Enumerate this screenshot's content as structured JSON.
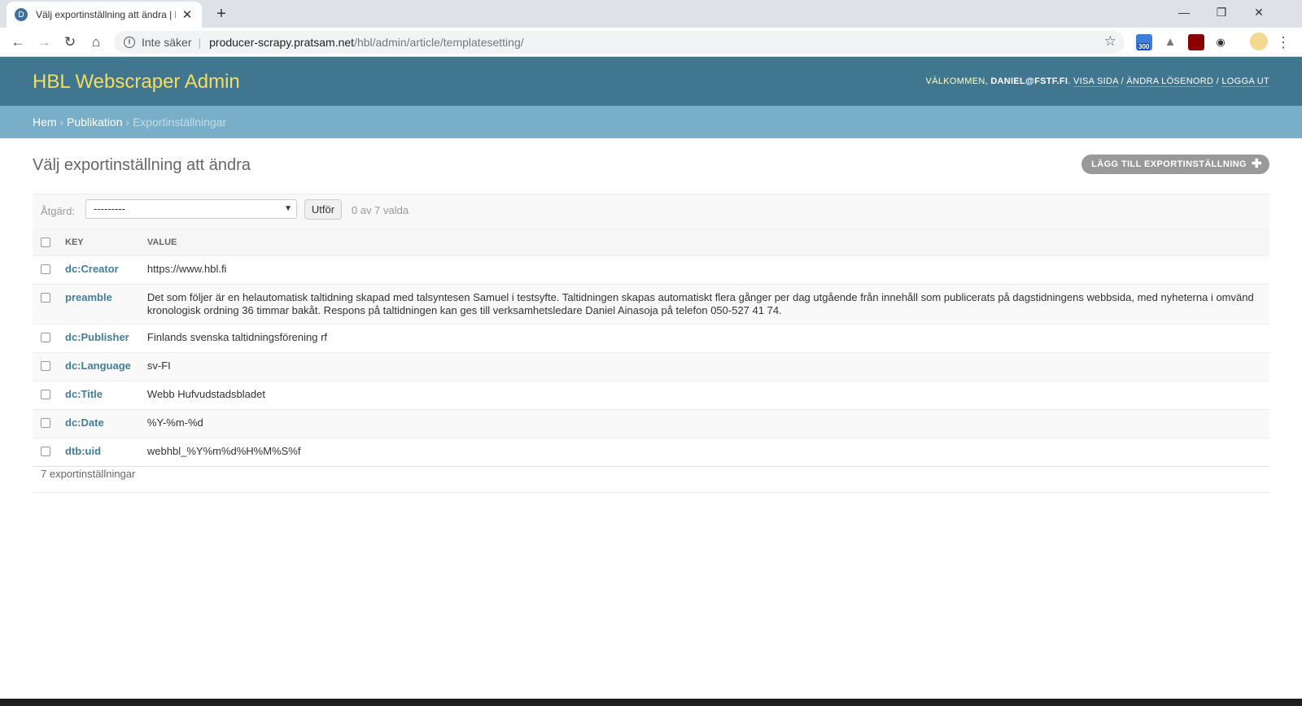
{
  "browser": {
    "tab_title": "Välj exportinställning att ändra | HBL Webscraper Admin",
    "tab_favicon_letter": "D",
    "security_label": "Inte säker",
    "url_host": "producer-scrapy.pratsam.net",
    "url_path": "/hbl/admin/article/templatesetting/",
    "extension_badge": "300"
  },
  "header": {
    "brand": "HBL Webscraper Admin",
    "welcome": "VÄLKOMMEN,",
    "user": "DANIEL@FSTF.FI",
    "view_site": "VISA SIDA",
    "change_password": "ÄNDRA LÖSENORD",
    "logout": "LOGGA UT",
    "separator": "/"
  },
  "breadcrumbs": {
    "home": "Hem",
    "app": "Publikation",
    "current": "Exportinställningar",
    "sep": "›"
  },
  "page": {
    "title": "Välj exportinställning att ändra",
    "add_button": "LÄGG TILL EXPORTINSTÄLLNING"
  },
  "actions": {
    "label": "Åtgärd:",
    "selected_option": "---------",
    "go_button": "Utför",
    "counter": "0 av 7 valda"
  },
  "table": {
    "columns": [
      "KEY",
      "VALUE"
    ],
    "rows": [
      {
        "key": "dc:Creator",
        "value": "https://www.hbl.fi"
      },
      {
        "key": "preamble",
        "value": "Det som följer är en helautomatisk taltidning skapad med talsyntesen Samuel i testsyfte. Taltidningen skapas automatiskt flera gånger per dag utgående från innehåll som publicerats på dagstidningens webbsida, med nyheterna i omvänd kronologisk ordning 36 timmar bakåt. Respons på taltidningen kan ges till verksamhetsledare Daniel Ainasoja på telefon 050-527 41 74."
      },
      {
        "key": "dc:Publisher",
        "value": "Finlands svenska taltidningsförening rf"
      },
      {
        "key": "dc:Language",
        "value": "sv-FI"
      },
      {
        "key": "dc:Title",
        "value": "Webb Hufvudstadsbladet"
      },
      {
        "key": "dc:Date",
        "value": "%Y-%m-%d"
      },
      {
        "key": "dtb:uid",
        "value": "webhbl_%Y%m%d%H%M%S%f"
      }
    ]
  },
  "paginator": "7 exportinställningar",
  "colors": {
    "header_bg": "#417690",
    "brand_yellow": "#f5dd5d",
    "breadcrumb_bg": "#79aec8",
    "link": "#447e9b"
  }
}
